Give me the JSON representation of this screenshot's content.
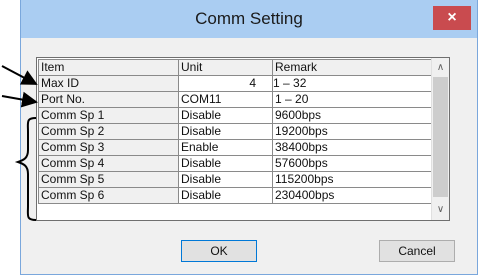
{
  "window": {
    "title": "Comm Setting",
    "close_icon": "×"
  },
  "grid": {
    "headers": [
      "Item",
      "Unit",
      "Remark"
    ],
    "rows": [
      {
        "item": "Max ID",
        "unit": "4",
        "remark": "1 – 32"
      },
      {
        "item": "Port No.",
        "unit": "COM11",
        "remark": "1 – 20"
      },
      {
        "item": "Comm Sp 1",
        "unit": "Disable",
        "remark": "9600bps"
      },
      {
        "item": "Comm Sp 2",
        "unit": "Disable",
        "remark": "19200bps"
      },
      {
        "item": "Comm Sp 3",
        "unit": "Enable",
        "remark": "38400bps"
      },
      {
        "item": "Comm Sp 4",
        "unit": "Disable",
        "remark": "57600bps"
      },
      {
        "item": "Comm Sp 5",
        "unit": "Disable",
        "remark": "115200bps"
      },
      {
        "item": "Comm Sp 6",
        "unit": "Disable",
        "remark": "230400bps"
      }
    ],
    "scroll_up_icon": "∧",
    "scroll_down_icon": "∨"
  },
  "buttons": {
    "ok_label": "OK",
    "cancel_label": "Cancel"
  },
  "colors": {
    "titlebar": "#aacdf2",
    "close_button": "#c94b4f",
    "default_button_border": "#0078d7"
  }
}
